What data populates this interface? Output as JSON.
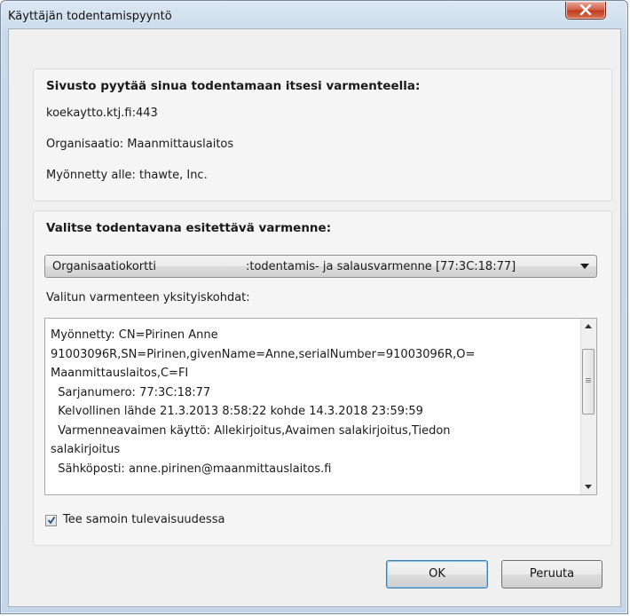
{
  "window": {
    "title": "Käyttäjän todentamispyyntö",
    "close_icon": "close-icon"
  },
  "site_info": {
    "heading": "Sivusto pyytää sinua todentamaan itsesi varmenteella:",
    "host": "koekaytto.ktj.fi:443",
    "organization": "Organisaatio: Maanmittauslaitos",
    "issued_to": "Myönnetty alle: thawte, Inc."
  },
  "certificate": {
    "heading": "Valitse todentavana esitettävä varmenne:",
    "selected_left": "Organisaatiokortti",
    "selected_right": ":todentamis- ja salausvarmenne [77:3C:18:77]",
    "details_label": "Valitun varmenteen yksityiskohdat:",
    "details_lines": [
      "Myönnetty: CN=Pirinen Anne",
      "91003096R,SN=Pirinen,givenName=Anne,serialNumber=91003096R,O=",
      "Maanmittauslaitos,C=FI",
      "  Sarjanumero: 77:3C:18:77",
      "  Kelvollinen lähde 21.3.2013 8:58:22 kohde 14.3.2018 23:59:59",
      "  Varmenneavaimen käyttö: Allekirjoitus,Avaimen salakirjoitus,Tiedon",
      "salakirjoitus",
      "  Sähköposti: anne.pirinen@maanmittauslaitos.fi"
    ]
  },
  "remember": {
    "label": "Tee samoin tulevaisuudessa",
    "checked": true
  },
  "buttons": {
    "ok": "OK",
    "cancel": "Peruuta"
  },
  "colors": {
    "accent": "#3c7fb1",
    "close": "#c0391f"
  }
}
